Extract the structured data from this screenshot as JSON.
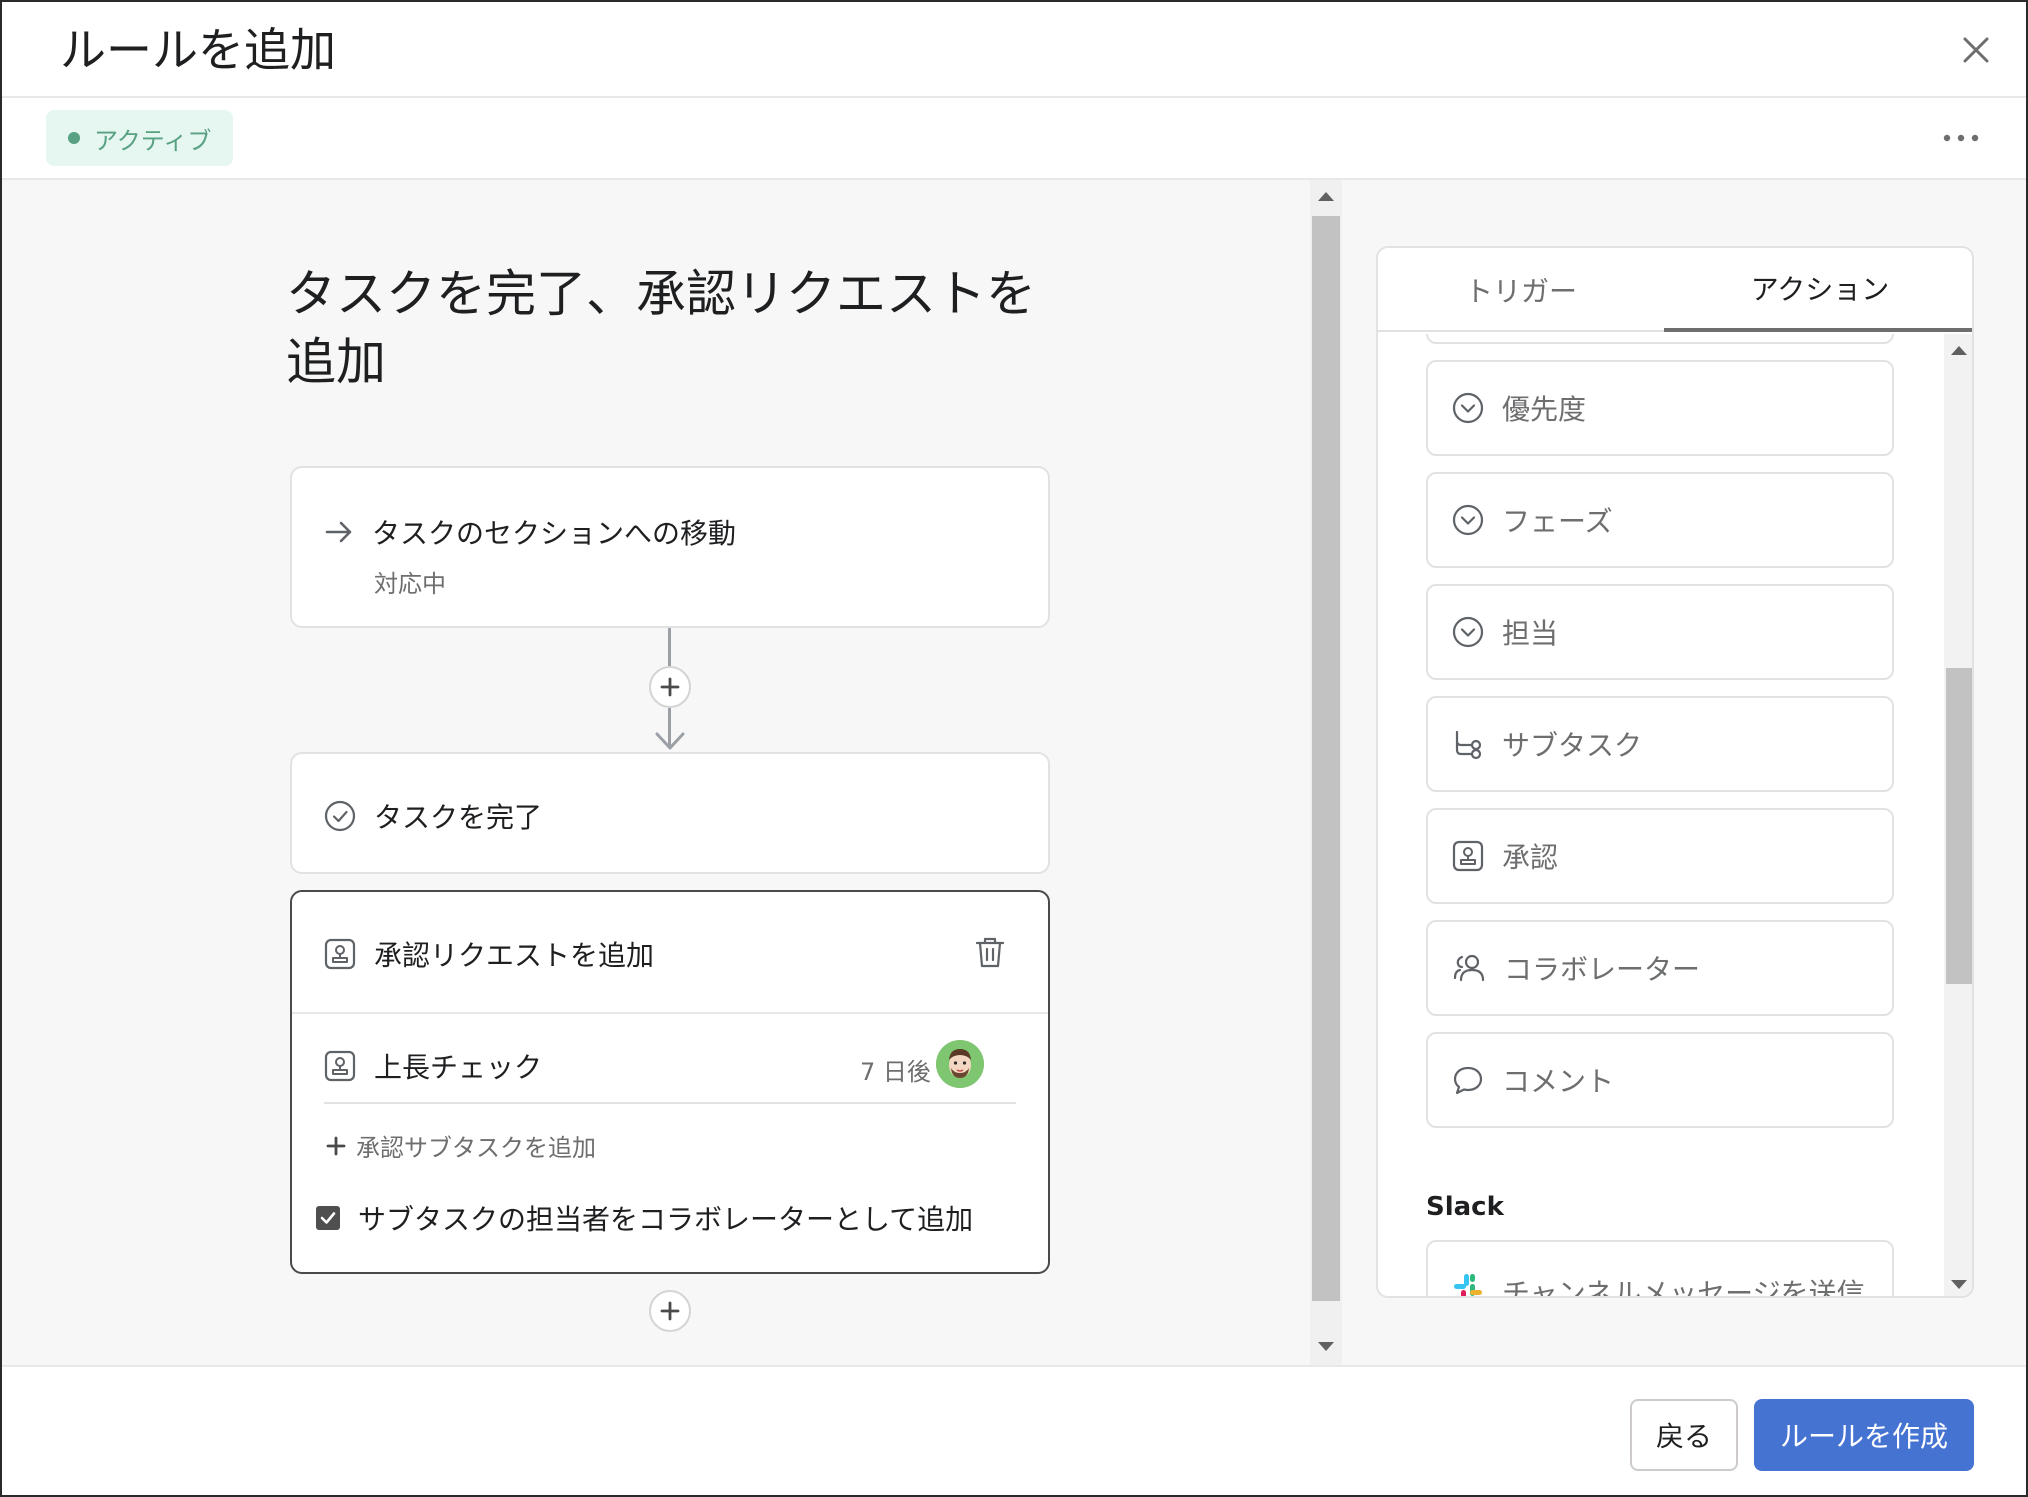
{
  "dialog": {
    "title": "ルールを追加",
    "close_icon": "close-icon",
    "more_icon": "more-horizontal-icon"
  },
  "status": {
    "label": "アクティブ",
    "color": "#58a182"
  },
  "rule": {
    "title": "タスクを完了、承認リクエストを追加",
    "trigger": {
      "icon": "arrow-right-icon",
      "label": "タスクのセクションへの移動",
      "sublabel": "対応中"
    },
    "actions": [
      {
        "icon": "check-circle-icon",
        "label": "タスクを完了"
      }
    ],
    "approval": {
      "icon": "approval-stamp-icon",
      "label": "承認リクエストを追加",
      "delete_icon": "trash-icon",
      "subtask": {
        "icon": "approval-stamp-icon",
        "label": "上長チェック",
        "due": "7 日後",
        "assignee_avatar": "avatar"
      },
      "add_subtask_label": "承認サブタスクを追加",
      "checkbox_label": "サブタスクの担当者をコラボレーターとして追加",
      "checkbox_checked": true
    }
  },
  "panel": {
    "tabs": [
      {
        "label": "トリガー",
        "active": false
      },
      {
        "label": "アクション",
        "active": true
      }
    ],
    "items": [
      {
        "icon": "chevron-circle-icon",
        "label": "優先度"
      },
      {
        "icon": "chevron-circle-icon",
        "label": "フェーズ"
      },
      {
        "icon": "chevron-circle-icon",
        "label": "担当"
      },
      {
        "icon": "subtask-icon",
        "label": "サブタスク"
      },
      {
        "icon": "approval-stamp-icon",
        "label": "承認"
      },
      {
        "icon": "collaborators-icon",
        "label": "コラボレーター"
      },
      {
        "icon": "comment-icon",
        "label": "コメント"
      }
    ],
    "section_slack": "Slack",
    "slack_item": {
      "icon": "slack-icon",
      "label": "チャンネルメッセージを送信"
    }
  },
  "footer": {
    "back_label": "戻る",
    "create_label": "ルールを作成",
    "accent": "#4573d2"
  }
}
